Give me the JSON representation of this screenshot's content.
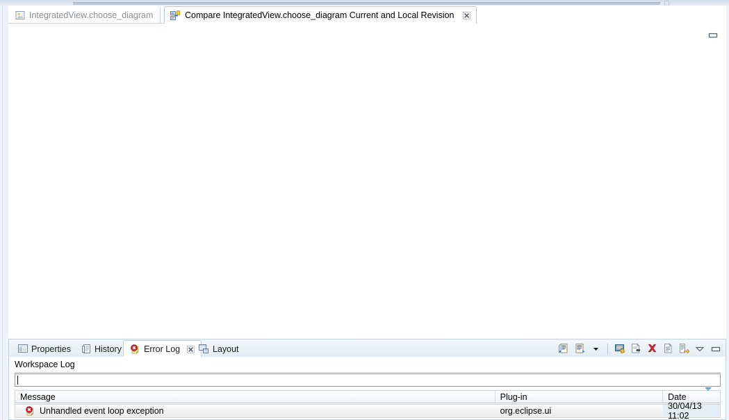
{
  "window": {
    "minimize_label": "minimize"
  },
  "editor": {
    "tabs": [
      {
        "label": "IntegratedView.choose_diagram",
        "icon": "image-file-icon",
        "active": false,
        "closable": false
      },
      {
        "label": "Compare IntegratedView.choose_diagram Current and Local Revision",
        "icon": "compare-editor-icon",
        "active": true,
        "closable": true,
        "close_icon": "close-icon"
      }
    ],
    "minimize_icon": "minimize-icon"
  },
  "view_stack": {
    "tabs": [
      {
        "label": "Properties",
        "icon": "properties-icon",
        "active": false,
        "closable": false
      },
      {
        "label": "History",
        "icon": "history-icon",
        "active": false,
        "closable": false
      },
      {
        "label": "Error Log",
        "icon": "error-log-icon",
        "active": true,
        "closable": true,
        "close_icon": "close-icon"
      },
      {
        "label": "Layout",
        "icon": "layout-icon",
        "active": false,
        "closable": false
      }
    ],
    "toolbar": [
      {
        "name": "export-log-icon",
        "title": "Export Log"
      },
      {
        "name": "import-log-icon",
        "title": "Import Log"
      },
      {
        "name": "chevron-down-icon",
        "title": "More"
      },
      {
        "name": "toolbar-separator",
        "title": ""
      },
      {
        "name": "open-event-details-icon",
        "title": "Open Event Log Details"
      },
      {
        "name": "clear-log-viewer-icon",
        "title": "Clear Log Viewer"
      },
      {
        "name": "delete-log-icon",
        "title": "Delete Log"
      },
      {
        "name": "open-log-icon",
        "title": "Open Log"
      },
      {
        "name": "restore-log-icon",
        "title": "Restore Log"
      },
      {
        "name": "view-menu-icon",
        "title": "View Menu"
      },
      {
        "name": "minimize-icon",
        "title": "Minimize"
      }
    ]
  },
  "error_log": {
    "section_label": "Workspace Log",
    "filter": {
      "value": "",
      "placeholder": ""
    },
    "columns": [
      {
        "key": "message",
        "label": "Message",
        "sorted": false
      },
      {
        "key": "plugin",
        "label": "Plug-in",
        "sorted": false
      },
      {
        "key": "date",
        "label": "Date",
        "sorted": true,
        "sort_icon": "sort-descending-icon"
      }
    ],
    "rows": [
      {
        "severity_icon": "error-icon",
        "message": "Unhandled event loop exception",
        "plugin": "org.eclipse.ui",
        "date": "30/04/13 11:02",
        "selected": true
      }
    ]
  },
  "colors": {
    "chrome_blue": "#cfdcea",
    "tab_border": "#b9c8da",
    "view_tab_gradient_top": "#f3f7fc",
    "view_tab_gradient_bottom": "#e4ecf6",
    "error_red": "#d9232a",
    "date_cell_blue": "#e5eef7",
    "inactive_tab_text": "#8b8f96"
  }
}
